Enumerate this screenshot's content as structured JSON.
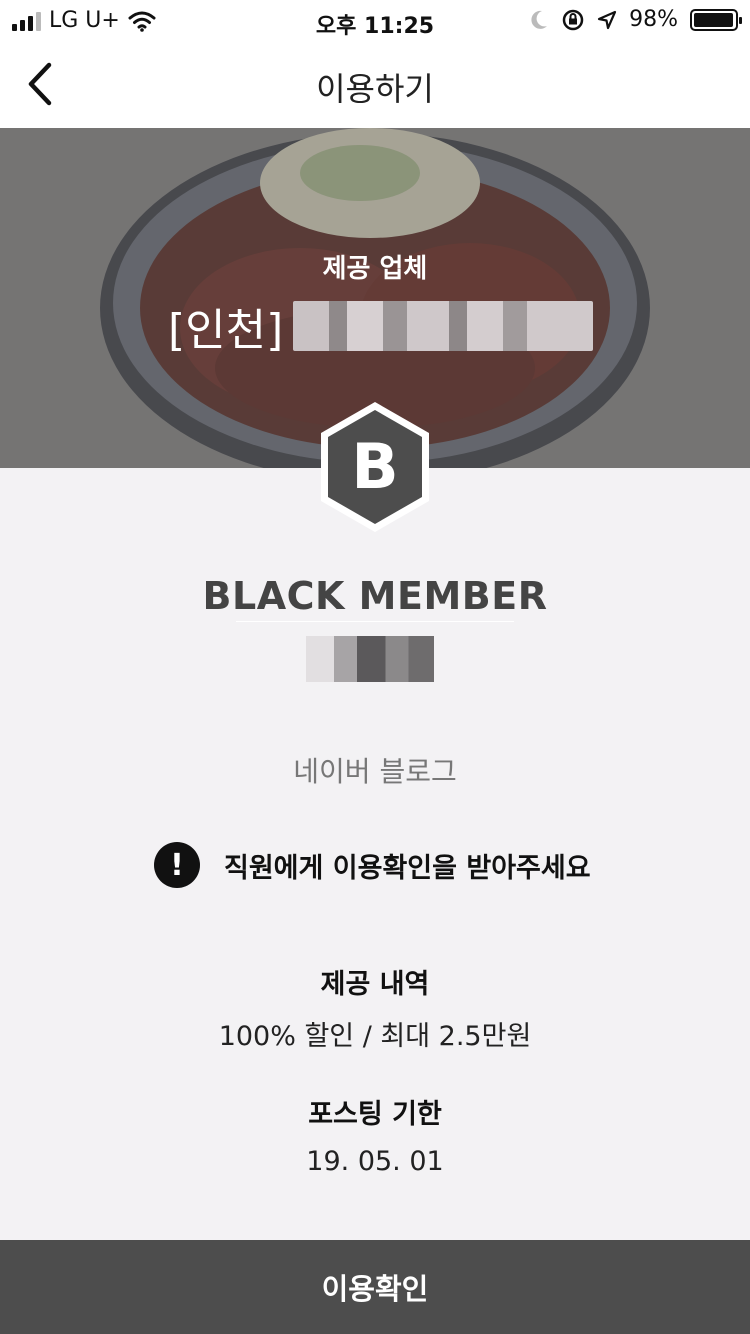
{
  "status_bar": {
    "carrier": "LG U+",
    "time": "오후 11:25",
    "battery_percent": "98%",
    "battery_level": 0.98,
    "icons": [
      "signal-icon",
      "wifi-icon",
      "moon-icon",
      "rotation-lock-icon",
      "location-icon",
      "battery-icon"
    ]
  },
  "nav": {
    "title": "이용하기",
    "back_icon": "chevron-left-icon"
  },
  "hero": {
    "label": "제공 업체",
    "company_prefix": "[인천]"
  },
  "badge": {
    "letter": "B",
    "color": "#4d4d4d"
  },
  "member": {
    "title": "BLACK MEMBER"
  },
  "channel": "네이버 블로그",
  "notice": {
    "text": "직원에게 이용확인을 받아주세요",
    "icon": "exclamation-circle-icon"
  },
  "offer": {
    "title": "제공 내역",
    "value": "100% 할인 / 최대 2.5만원"
  },
  "deadline": {
    "title": "포스팅 기한",
    "value": "19. 05. 01"
  },
  "confirm_button": {
    "label": "이용확인"
  }
}
